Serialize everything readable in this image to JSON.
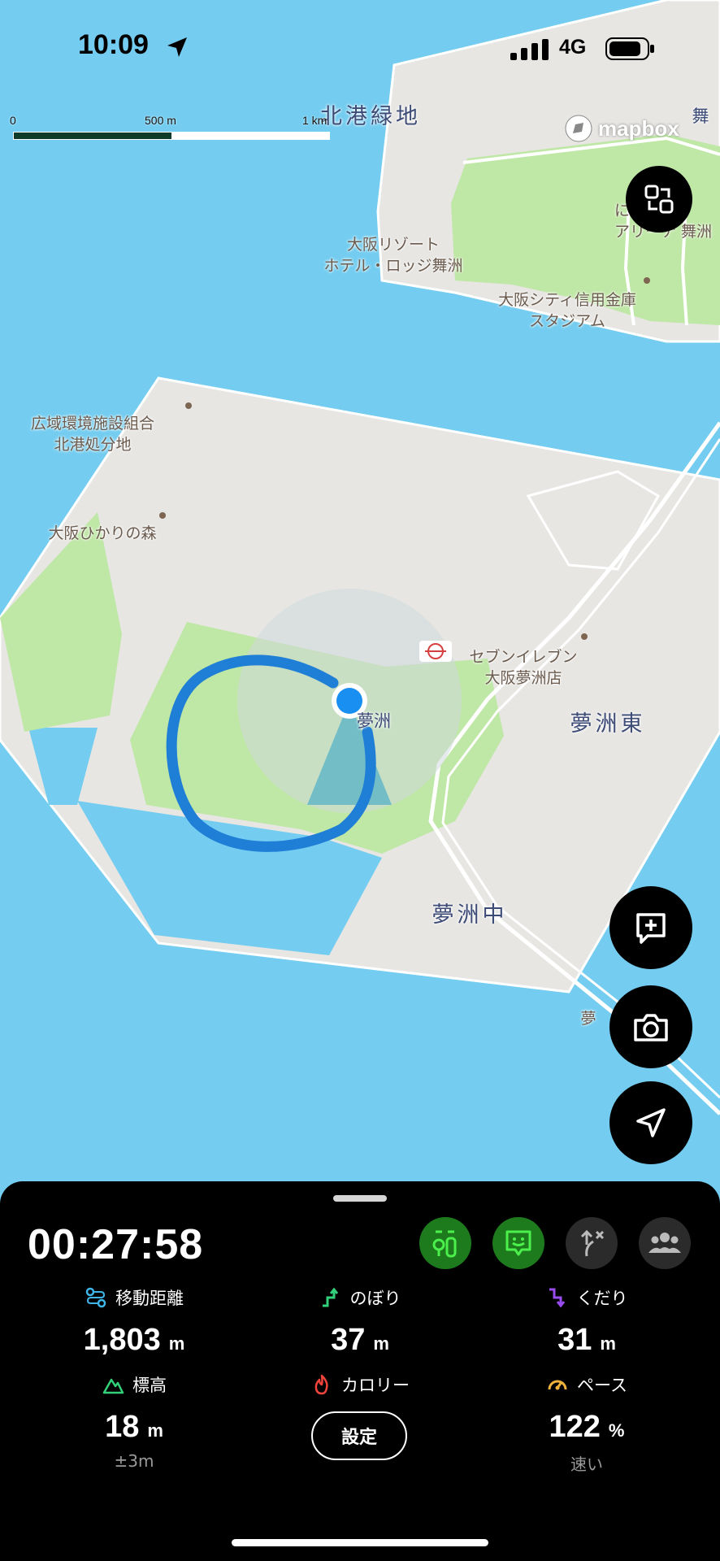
{
  "status": {
    "time": "10:09",
    "network": "4G"
  },
  "map": {
    "scale": {
      "zero": "0",
      "mid": "500 m",
      "max": "1 km"
    },
    "attribution": "mapbox",
    "labels": {
      "hokko_ryokuchi": "北港緑地",
      "resort_hotel": "大阪リゾート\nホテル・ロッジ舞洲",
      "arena": "に\nアリーナ 舞洲",
      "stadium": "大阪シティ信用金庫\nスタジアム",
      "mai_partial": "舞",
      "disposal_site": "広域環境施設組合\n北港処分地",
      "hikari_forest": "大阪ひかりの森",
      "seven_eleven": "セブンイレブン\n大阪夢洲店",
      "yumeshima": "夢洲",
      "yumeshima_higashi": "夢洲東",
      "yumeshima_naka": "夢洲中",
      "yume_partial": "夢"
    },
    "colors": {
      "water": "#74cdf0",
      "land": "#e7e6e3",
      "park": "#bfe7a6",
      "route": "#1f7ed6",
      "location": "#1a8ff2"
    }
  },
  "buttons": {
    "collapse": "collapse-icon",
    "add_memo": "add-memo-icon",
    "camera": "camera-icon",
    "locate": "navigation-arrow-icon"
  },
  "panel": {
    "elapsed": "00:27:58",
    "modes": [
      "trail-signs-icon",
      "smile-message-icon",
      "route-off-icon",
      "group-icon"
    ],
    "stats": {
      "distance": {
        "label": "移動距離",
        "value": "1,803",
        "unit": "m"
      },
      "ascent": {
        "label": "のぼり",
        "value": "37",
        "unit": "m"
      },
      "descent": {
        "label": "くだり",
        "value": "31",
        "unit": "m"
      },
      "altitude": {
        "label": "標高",
        "value": "18",
        "unit": "m",
        "sub": "±3m"
      },
      "calories": {
        "label": "カロリー",
        "button": "設定"
      },
      "pace": {
        "label": "ペース",
        "value": "122",
        "unit": "%",
        "sub": "速い"
      }
    }
  }
}
